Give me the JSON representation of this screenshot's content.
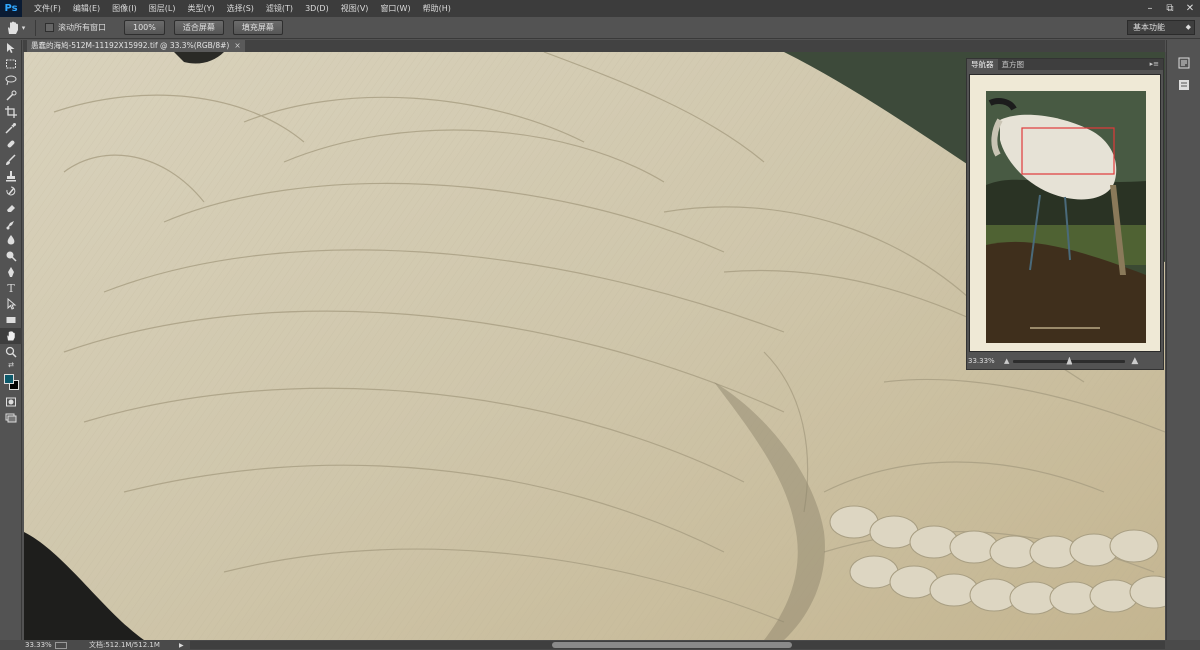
{
  "app": {
    "logo": "Ps",
    "menu": [
      "文件(F)",
      "编辑(E)",
      "图像(I)",
      "图层(L)",
      "类型(Y)",
      "选择(S)",
      "滤镜(T)",
      "3D(D)",
      "视图(V)",
      "窗口(W)",
      "帮助(H)"
    ],
    "window_controls": [
      "minimize-icon",
      "restore-icon",
      "close-icon"
    ]
  },
  "options": {
    "tool_icon": "hand-icon",
    "scroll_all_windows_label": "滚动所有窗口",
    "scroll_all_windows_checked": false,
    "buttons": [
      "100%",
      "适合屏幕",
      "填充屏幕"
    ],
    "workspace": "基本功能"
  },
  "toolbox": {
    "tools": [
      "move-icon",
      "marquee-icon",
      "lasso-icon",
      "quick-select-icon",
      "crop-icon",
      "eyedropper-icon",
      "healing-brush-icon",
      "brush-icon",
      "clone-stamp-icon",
      "history-brush-icon",
      "eraser-icon",
      "gradient-icon",
      "blur-icon",
      "dodge-icon",
      "pen-icon",
      "type-icon",
      "path-select-icon",
      "rectangle-icon",
      "hand-icon",
      "zoom-icon"
    ],
    "active_tool": "hand-icon",
    "foreground_color": "#0d5a6b",
    "background_color": "#000000"
  },
  "document": {
    "tab_title": "愚蠢的海鸠-512M-11192X15992.tif @ 33.3%(RGB/8#)",
    "close": "×"
  },
  "navigator": {
    "tabs": [
      "导航器",
      "直方图"
    ],
    "active_tab": "导航器",
    "zoom": "33.33%",
    "zoom_slider_fraction": 0.5,
    "view_box_color": "#e03a3a"
  },
  "status": {
    "zoom": "33.33%",
    "doc_info": "文档:512.1M/512.1M",
    "arrow": "▶"
  }
}
